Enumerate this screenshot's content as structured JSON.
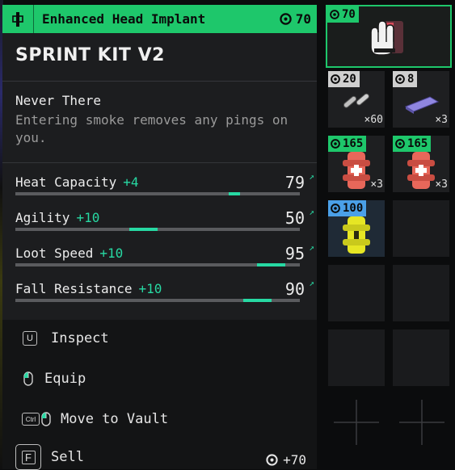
{
  "tooltip": {
    "category": "Enhanced Head Implant",
    "header_price": "70",
    "name": "SPRINT KIT V2",
    "perk": {
      "title": "Never There",
      "description": "Entering smoke removes any pings on you."
    },
    "stats": [
      {
        "label": "Heat Capacity",
        "bonus": "+4",
        "value": "79",
        "fill": 0.79,
        "bonus_fill": 0.04
      },
      {
        "label": "Agility",
        "bonus": "+10",
        "value": "50",
        "fill": 0.5,
        "bonus_fill": 0.1
      },
      {
        "label": "Loot Speed",
        "bonus": "+10",
        "value": "95",
        "fill": 0.95,
        "bonus_fill": 0.1
      },
      {
        "label": "Fall Resistance",
        "bonus": "+10",
        "value": "90",
        "fill": 0.9,
        "bonus_fill": 0.1
      }
    ],
    "actions": {
      "inspect": {
        "key": "U",
        "label": "Inspect"
      },
      "equip": {
        "label": "Equip"
      },
      "vault": {
        "key": "Ctrl",
        "label": "Move to Vault"
      },
      "sell": {
        "key": "F",
        "label": "Sell",
        "price": "+70"
      }
    }
  },
  "inventory": {
    "selected": {
      "price": "70",
      "icon": "glove-implant-icon"
    },
    "slots": [
      {
        "price": "20",
        "qty": "×60",
        "icon": "ammo-icon",
        "tag": "grey"
      },
      {
        "price": "8",
        "qty": "×3",
        "icon": "battery-icon",
        "tag": "grey"
      },
      {
        "price": "165",
        "qty": "×3",
        "icon": "medkit-icon",
        "tag": "green"
      },
      {
        "price": "165",
        "qty": "×3",
        "icon": "medkit-icon",
        "tag": "green"
      },
      {
        "price": "100",
        "qty": "",
        "icon": "yellow-implant-icon",
        "tag": "blue"
      }
    ]
  },
  "colors": {
    "accent": "#1ec76b",
    "bonus": "#27d9a3",
    "tag_blue": "#4aa0e8"
  }
}
